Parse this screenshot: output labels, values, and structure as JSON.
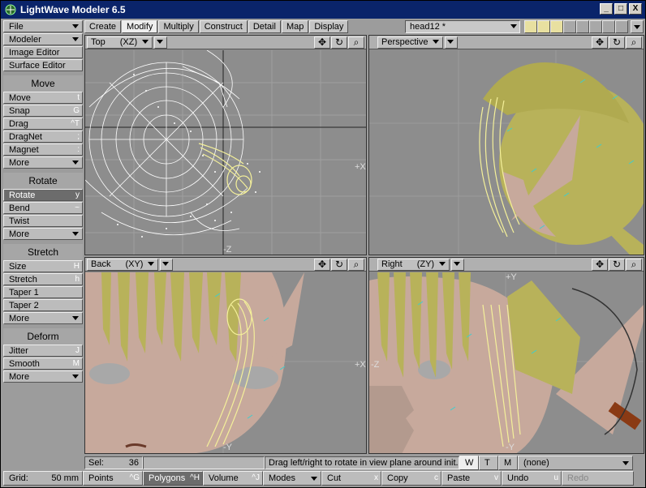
{
  "window": {
    "title": "LightWave Modeler 6.5",
    "min": "_",
    "max": "□",
    "close": "X"
  },
  "sidebar": {
    "top_items": [
      {
        "label": "File",
        "dropdown": true
      },
      {
        "label": "Modeler",
        "dropdown": true
      },
      {
        "label": "Image Editor"
      },
      {
        "label": "Surface Editor"
      }
    ],
    "groups": [
      {
        "heading": "Move",
        "items": [
          {
            "label": "Move",
            "shortcut": "t"
          },
          {
            "label": "Snap",
            "shortcut": "G"
          },
          {
            "label": "Drag",
            "shortcut": "^T"
          },
          {
            "label": "DragNet",
            "shortcut": ";"
          },
          {
            "label": "Magnet",
            "shortcut": ":"
          },
          {
            "label": "More",
            "dropdown": true
          }
        ]
      },
      {
        "heading": "Rotate",
        "items": [
          {
            "label": "Rotate",
            "shortcut": "y",
            "active": true
          },
          {
            "label": "Bend",
            "shortcut": "~"
          },
          {
            "label": "Twist"
          },
          {
            "label": "More",
            "dropdown": true
          }
        ]
      },
      {
        "heading": "Stretch",
        "items": [
          {
            "label": "Size",
            "shortcut": "H"
          },
          {
            "label": "Stretch",
            "shortcut": "h"
          },
          {
            "label": "Taper 1"
          },
          {
            "label": "Taper 2"
          },
          {
            "label": "More",
            "dropdown": true
          }
        ]
      },
      {
        "heading": "Deform",
        "items": [
          {
            "label": "Jitter",
            "shortcut": "J"
          },
          {
            "label": "Smooth",
            "shortcut": "M"
          },
          {
            "label": "More",
            "dropdown": true
          }
        ]
      }
    ]
  },
  "tabs": [
    "Create",
    "Modify",
    "Multiply",
    "Construct",
    "Detail",
    "Map",
    "Display"
  ],
  "active_tab": "Modify",
  "object_selector": "head12 *",
  "viewports": {
    "top_left": {
      "view": "Top",
      "axes": "(XZ)",
      "axis_right": "+X",
      "axis_bottom": "-Z"
    },
    "top_right": {
      "view": "Perspective"
    },
    "bottom_left": {
      "view": "Back",
      "axes": "(XY)",
      "axis_right": "+X",
      "axis_bottom": "-Y"
    },
    "bottom_right": {
      "view": "Right",
      "axes": "(ZY)",
      "axis_top": "+Y",
      "axis_left": "-Z",
      "axis_bottom": "-Y"
    }
  },
  "status": {
    "sel_label": "Sel:",
    "sel_count": "36",
    "message": "Drag left/right to rotate in view plane around init...",
    "wtm": [
      "W",
      "T",
      "M"
    ],
    "surface": "(none)"
  },
  "bottom": {
    "grid_label": "Grid:",
    "grid_value": "50 mm",
    "modes": [
      {
        "label": "Points",
        "shortcut": "^G"
      },
      {
        "label": "Polygons",
        "shortcut": "^H",
        "active": true
      },
      {
        "label": "Volume",
        "shortcut": "^J"
      }
    ],
    "modes_menu": "Modes",
    "actions": [
      {
        "label": "Cut",
        "shortcut": "x"
      },
      {
        "label": "Copy",
        "shortcut": "c"
      },
      {
        "label": "Paste",
        "shortcut": "v"
      },
      {
        "label": "Undo",
        "shortcut": "u"
      },
      {
        "label": "Redo",
        "disabled": true
      }
    ]
  },
  "colors": {
    "hair": "#b8b25a",
    "skin": "#c7a99c",
    "wire": "#ffffff",
    "selected": "#f4f09a",
    "normals": "#3ad0d0"
  }
}
